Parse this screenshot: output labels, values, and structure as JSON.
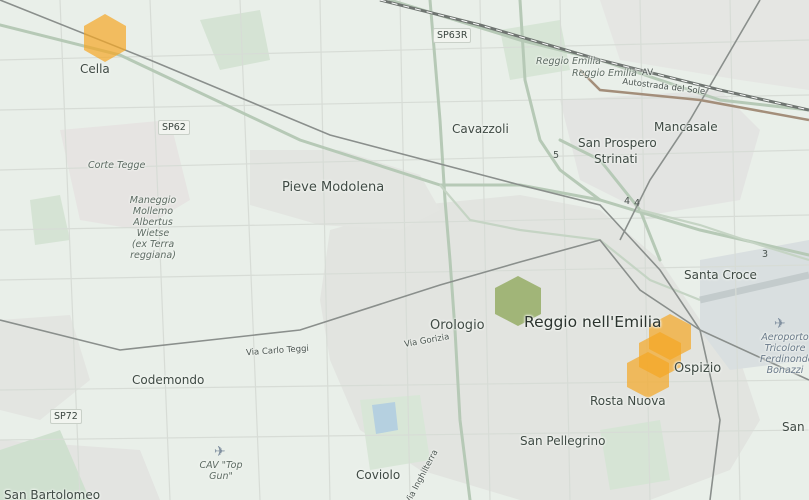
{
  "map": {
    "labels": {
      "cella": "Cella",
      "cavazzoli": "Cavazzoli",
      "reggio_emilia_station": "Reggio Emilia",
      "reggio_emilia_av": "Reggio Emilia",
      "av": "AV",
      "autostrada": "Autostrada del Sole",
      "mancasale": "Mancasale",
      "san_prospero": "San Prospero",
      "strinati": "Strinati",
      "corte_tegge": "Corte Tegge",
      "pieve_modolena": "Pieve Modolena",
      "maneggio": "Maneggio Mollemo Albertus Wietse (ex Terra reggiana)",
      "santa_croce": "Santa Croce",
      "reggio_nellemilia": "Reggio nell'Emilia",
      "orologio": "Orologio",
      "aeroporto": "Aeroporto Tricolore Ferdinondo Bonazzi",
      "via_carlo_teggi": "Via Carlo Teggi",
      "via_gorizia": "Via Gorizia",
      "codemondo": "Codemondo",
      "ospizio": "Ospizio",
      "rosta_nuova": "Rosta Nuova",
      "san_pellegrino": "San Pellegrino",
      "cav": "CAV \"Top Gun\"",
      "coviolo": "Coviolo",
      "via_inghilterra": "Via Inghilterra",
      "san_bartolomeo": "San Bartolomeo",
      "sanm": "San M"
    },
    "shields": {
      "sp63r": "SP63R",
      "sp62": "SP62",
      "sp72": "SP72"
    },
    "road_numbers": {
      "five": "5",
      "four_a": "4",
      "four_b": "4",
      "three": "3"
    },
    "hexagons": [
      {
        "id": "hex-cella",
        "color": "#f5a623",
        "opacity": 0.7
      },
      {
        "id": "hex-centro",
        "color": "#6b8e23",
        "opacity": 0.55
      },
      {
        "id": "hex-ospizio-top",
        "color": "#f5a623",
        "opacity": 0.7
      },
      {
        "id": "hex-ospizio-mid",
        "color": "#f5a623",
        "opacity": 0.7
      },
      {
        "id": "hex-rosta-nuova",
        "color": "#f5a623",
        "opacity": 0.7
      }
    ],
    "colors": {
      "background": "#e9efe9",
      "urban": "#e2e4e0",
      "green": "#d5e3d4",
      "major_road": "#b6c9b6",
      "railway": "#8a8f8c",
      "water": "#b5d0e0",
      "airport": "#d9dfe0"
    },
    "icons": [
      "airport-icon",
      "airfield-icon"
    ]
  }
}
